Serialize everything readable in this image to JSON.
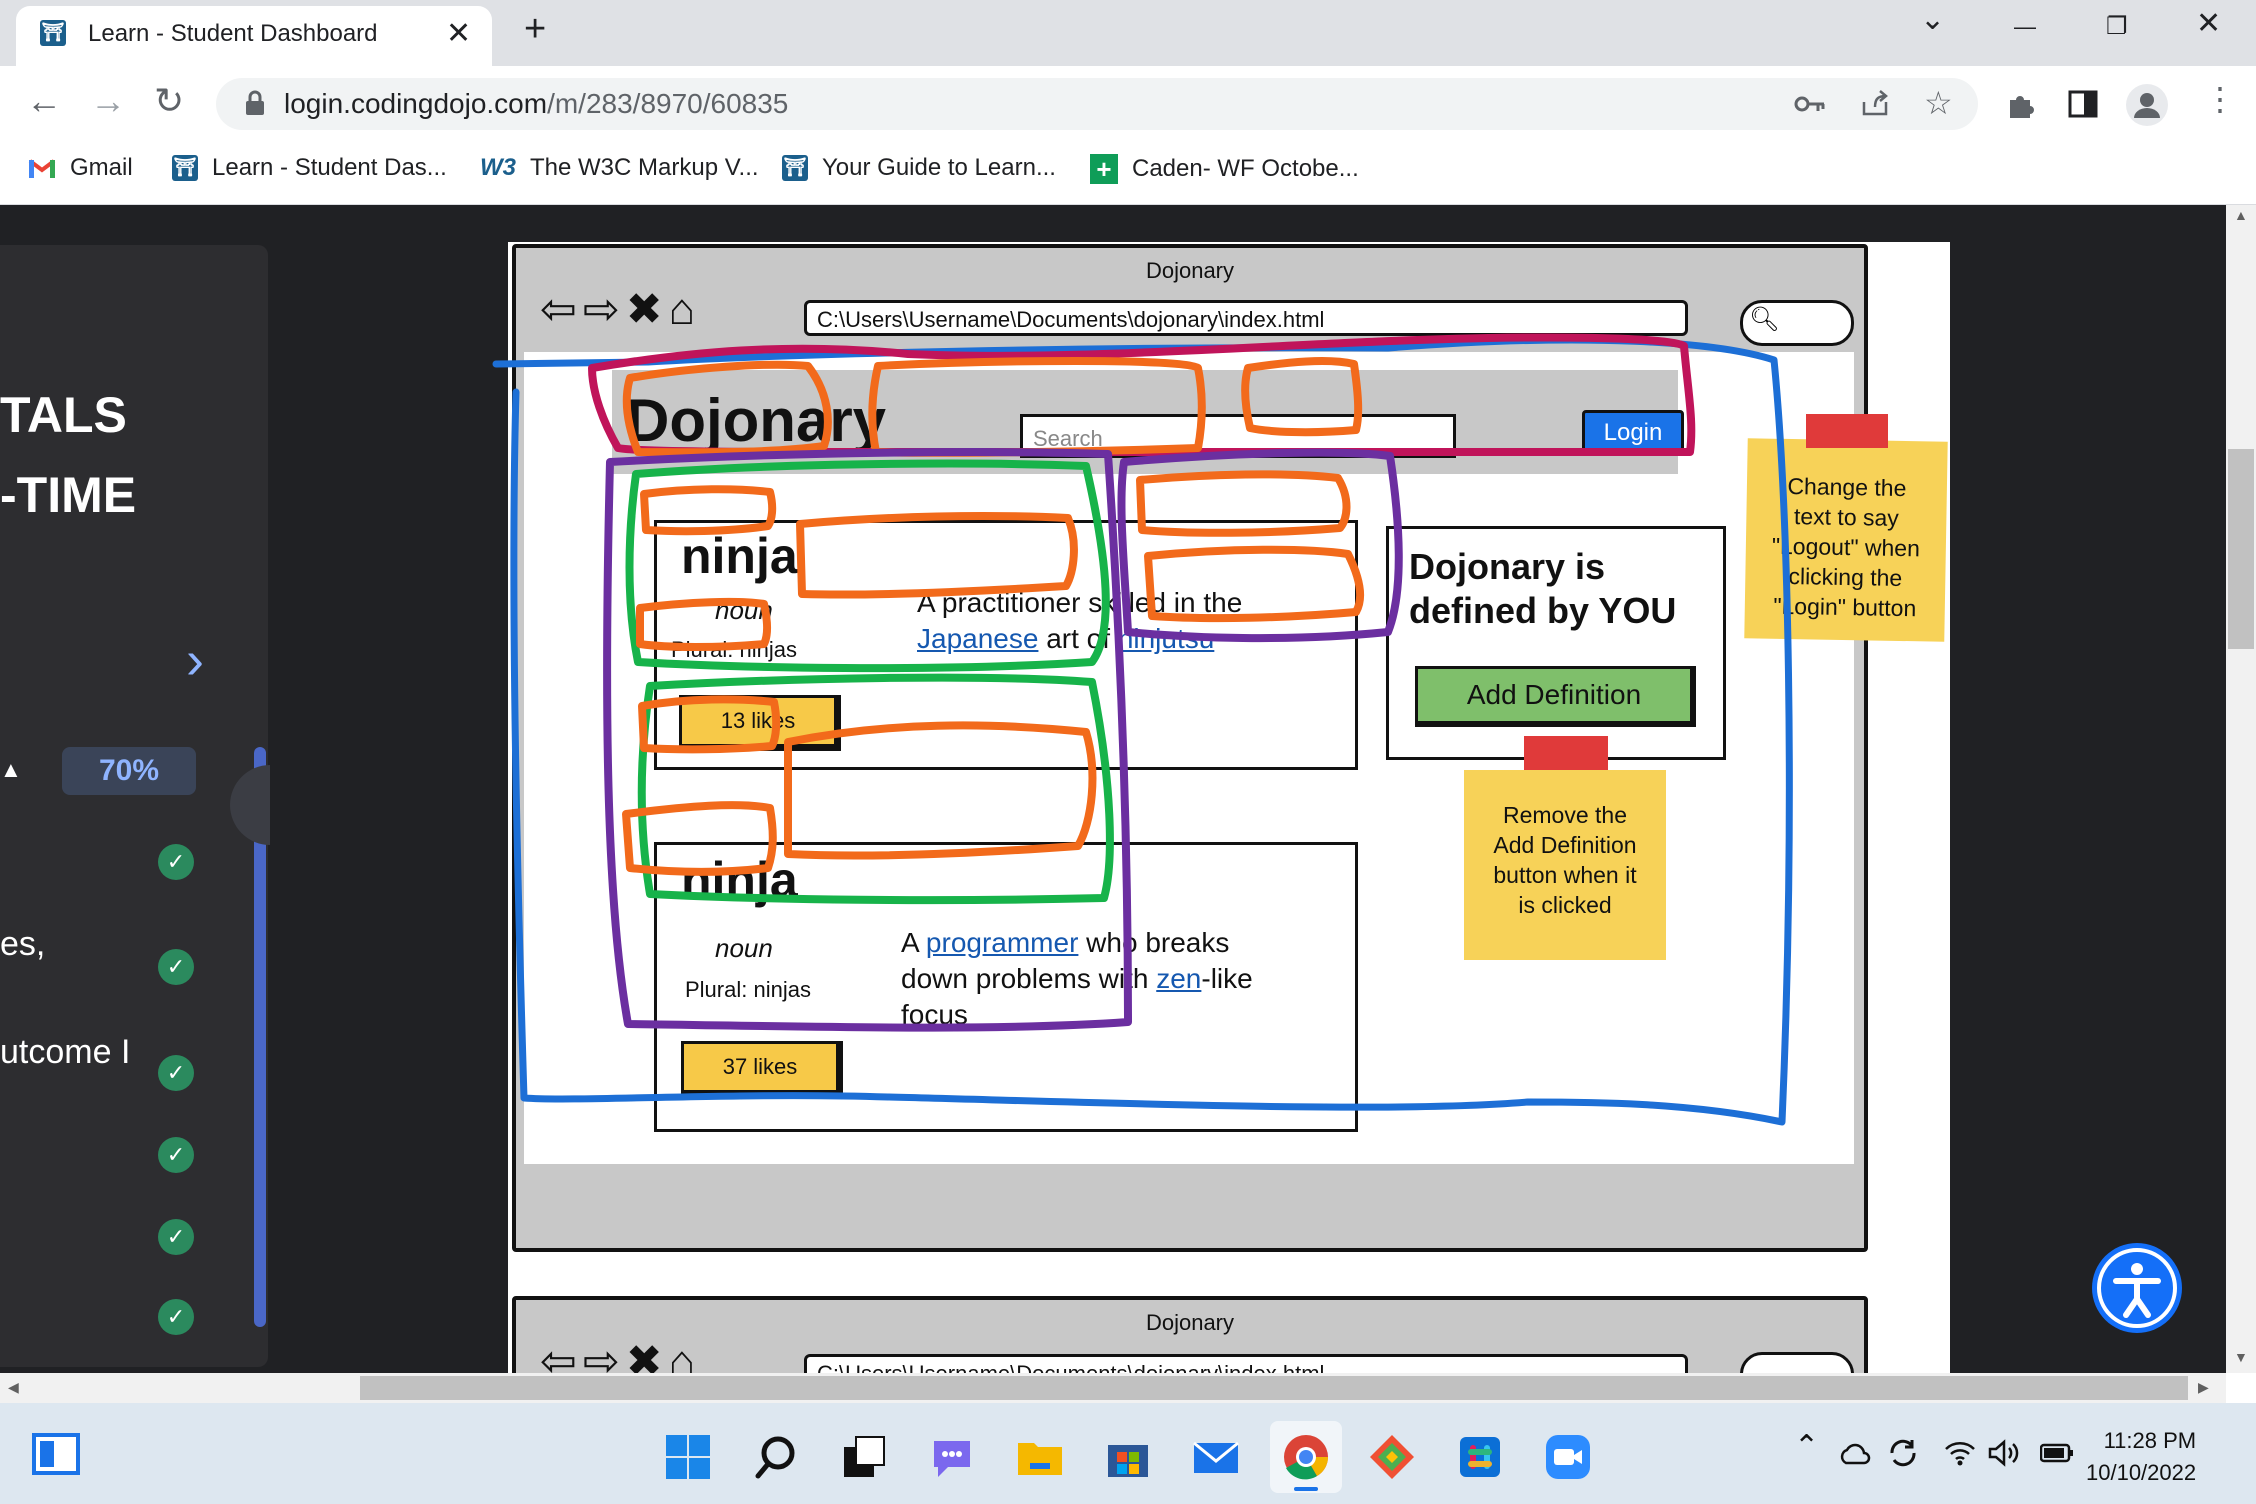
{
  "browser": {
    "tab": {
      "title": "Learn - Student Dashboard",
      "close": "✕"
    },
    "new_tab": "+",
    "window_controls": {
      "dropdown": "⌄",
      "minimize": "—",
      "restore": "❐",
      "close": "✕"
    },
    "url": {
      "domain": "login.codingdojo.com",
      "path": "/m/283/8970/60835"
    },
    "bookmarks": [
      {
        "label": "Gmail"
      },
      {
        "label": "Learn - Student Das..."
      },
      {
        "label": "The W3C Markup V..."
      },
      {
        "label": "Your Guide to Learn..."
      },
      {
        "label": "Caden- WF Octobe..."
      }
    ]
  },
  "sidebar": {
    "title_line1": "TALS",
    "title_line2": "-TIME",
    "progress": "70%",
    "progress_value": 0.7,
    "text1": "es,",
    "text2": "utcome I",
    "check_glyph": "✓",
    "chevron": "›"
  },
  "wireframe": {
    "window_title": "Dojonary",
    "file_path": "C:\\Users\\Username\\Documents\\dojonary\\index.html",
    "brand": "Dojonary",
    "search_placeholder": "Search",
    "login_label": "Login",
    "entries": [
      {
        "word": "ninja",
        "pos": "noun",
        "plural": "Plural: ninjas",
        "likes": "13 likes",
        "definition_parts": {
          "p1": "A practitioner skilled in the ",
          "link1": "Japanese",
          "p2": " art of ",
          "link2": "ninjutsu"
        }
      },
      {
        "word": "ninja",
        "pos": "noun",
        "plural": "Plural: ninjas",
        "likes": "37 likes",
        "definition_parts": {
          "p1": "A ",
          "link1": "programmer",
          "p2": " who breaks down problems with ",
          "link2": "zen",
          "p3": "-like focus"
        }
      }
    ],
    "side_card": {
      "line1": "Dojonary is",
      "line2": "defined by YOU",
      "button": "Add Definition"
    },
    "sticky_notes": [
      {
        "text_lines": [
          "Change the",
          "text to say",
          "\"Logout\" when",
          "clicking the",
          "\"Login\" button"
        ]
      },
      {
        "text_lines": [
          "Remove the",
          "Add Definition",
          "button when it",
          "is clicked"
        ]
      }
    ]
  },
  "taskbar": {
    "time": "11:28 PM",
    "date": "10/10/2022"
  },
  "colors": {
    "annotation_blue": "#1d6fd6",
    "annotation_magenta": "#c0145a",
    "annotation_orange": "#f26a1b",
    "annotation_green": "#17b34a",
    "annotation_purple": "#6b2fa0",
    "accent_blue": "#1a73e8"
  }
}
